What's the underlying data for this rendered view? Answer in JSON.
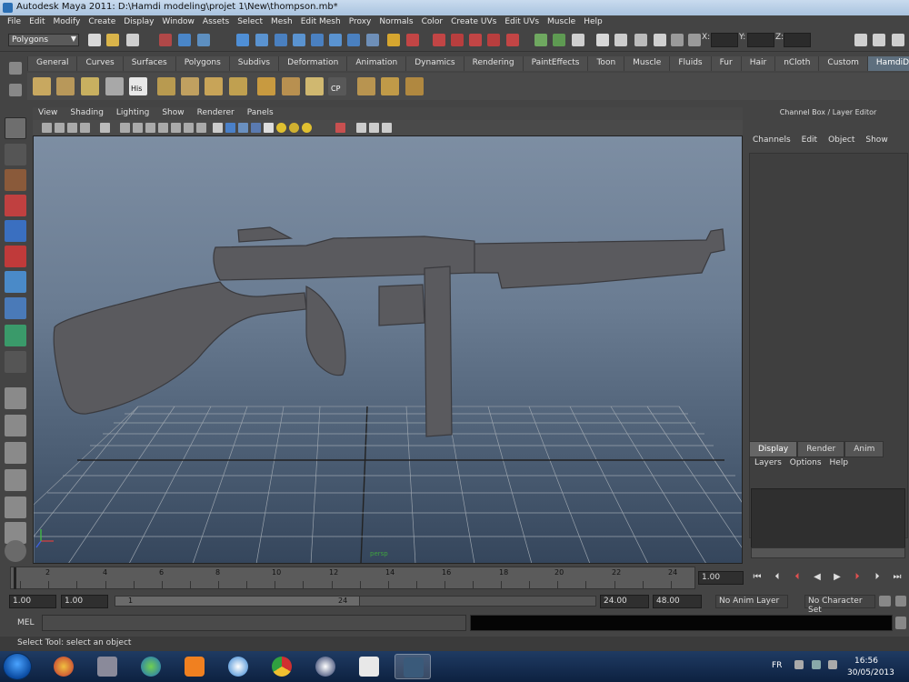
{
  "window": {
    "title": "Autodesk Maya 2011: D:\\Hamdi modeling\\projet 1\\New\\thompson.mb*"
  },
  "menubar": [
    "File",
    "Edit",
    "Modify",
    "Create",
    "Display",
    "Window",
    "Assets",
    "Select",
    "Mesh",
    "Edit Mesh",
    "Proxy",
    "Normals",
    "Color",
    "Create UVs",
    "Edit UVs",
    "Muscle",
    "Help"
  ],
  "status_line": {
    "mode": "Polygons",
    "x_label": "X:",
    "y_label": "Y:",
    "z_label": "Z:"
  },
  "shelf": {
    "tabs": [
      "General",
      "Curves",
      "Surfaces",
      "Polygons",
      "Subdivs",
      "Deformation",
      "Animation",
      "Dynamics",
      "Rendering",
      "PaintEffects",
      "Toon",
      "Muscle",
      "Fluids",
      "Fur",
      "Hair",
      "nCloth",
      "Custom",
      "HamdiDesigners"
    ],
    "active_tab": "HamdiDesigners",
    "icon_labels": [
      "His",
      "CP"
    ]
  },
  "panel": {
    "menu": [
      "View",
      "Shading",
      "Lighting",
      "Show",
      "Renderer",
      "Panels"
    ],
    "viewport_label": "persp"
  },
  "channel_box": {
    "title": "Channel Box / Layer Editor",
    "menu": [
      "Channels",
      "Edit",
      "Object",
      "Show"
    ],
    "layer_tabs": [
      "Display",
      "Render",
      "Anim"
    ],
    "active_layer_tab": "Display",
    "layer_menu": [
      "Layers",
      "Options",
      "Help"
    ]
  },
  "time_slider": {
    "ticks": [
      "2",
      "4",
      "6",
      "8",
      "10",
      "12",
      "14",
      "16",
      "18",
      "20",
      "22",
      "24"
    ],
    "current_frame": "1.00"
  },
  "range_slider": {
    "start_time": "1.00",
    "range_start": "1.00",
    "slider_start": "1",
    "slider_end": "24",
    "range_end": "24.00",
    "end_time": "48.00",
    "anim_layer": "No Anim Layer",
    "character_set": "No Character Set"
  },
  "command_line": {
    "label": "MEL"
  },
  "help_line": "Select Tool: select an object",
  "taskbar": {
    "lang": "FR",
    "time": "16:56",
    "date": "30/05/2013"
  },
  "colors": {
    "maya_bg": "#444444",
    "viewport_top": "#7d8ea3",
    "viewport_bottom": "#35465c",
    "grid": "#9aa3ad",
    "model": "#5a5a5e",
    "taskbar": "#1f3b63"
  }
}
